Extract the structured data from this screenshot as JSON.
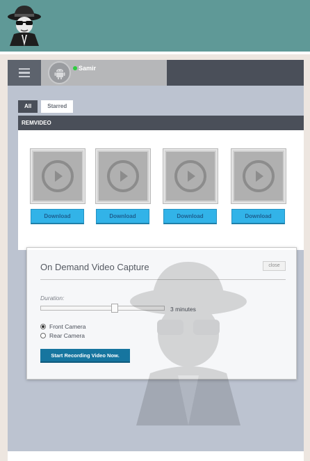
{
  "header": {
    "logo_icon": "spy-logo-icon",
    "background": "#5f9997"
  },
  "navbar": {
    "menu_icon": "hamburger-menu-icon",
    "user": {
      "name": "Samir",
      "avatar_icon": "android-icon",
      "status": "online"
    }
  },
  "tabs": [
    {
      "label": "All",
      "active": true
    },
    {
      "label": "Starred",
      "active": false
    }
  ],
  "section": {
    "title": "REMVIDEO"
  },
  "videos": [
    {
      "thumb_icon": "play-icon",
      "download_label": "Download"
    },
    {
      "thumb_icon": "play-icon",
      "download_label": "Download"
    },
    {
      "thumb_icon": "play-icon",
      "download_label": "Download"
    },
    {
      "thumb_icon": "play-icon",
      "download_label": "Download"
    }
  ],
  "modal": {
    "title": "On Demand Video Capture",
    "close_label": "close",
    "duration_label": "Duration:",
    "duration_value": "3 minutes",
    "duration_fraction": 0.6,
    "camera_options": [
      {
        "label": "Front Camera",
        "selected": true
      },
      {
        "label": "Rear Camera",
        "selected": false
      }
    ],
    "record_button": "Start Recording Video Now."
  },
  "colors": {
    "accent": "#32b3e8",
    "dark": "#4a4f59",
    "record": "#16759f"
  }
}
